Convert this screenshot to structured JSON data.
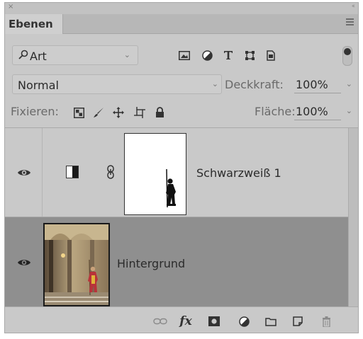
{
  "panel": {
    "close_glyph": "×",
    "collapse_glyph": "‹‹",
    "tab_label": "Ebenen"
  },
  "filter": {
    "kind_label": "Art",
    "chevron": "⌄"
  },
  "blend": {
    "mode": "Normal",
    "opacity_label": "Deckkraft:",
    "opacity_value": "100%"
  },
  "lock": {
    "label": "Fixieren:",
    "fill_label": "Fläche:",
    "fill_value": "100%"
  },
  "layers": [
    {
      "name": "Schwarzweiß 1",
      "type": "adjustment",
      "visible": true,
      "selected": false
    },
    {
      "name": "Hintergrund",
      "type": "pixel",
      "visible": true,
      "selected": true
    }
  ],
  "colors": {
    "panel_bg": "#c9c9c9",
    "selected_layer_bg": "#8f8f8f",
    "text": "#2b2b2b",
    "muted_text": "#6a6a6a"
  }
}
